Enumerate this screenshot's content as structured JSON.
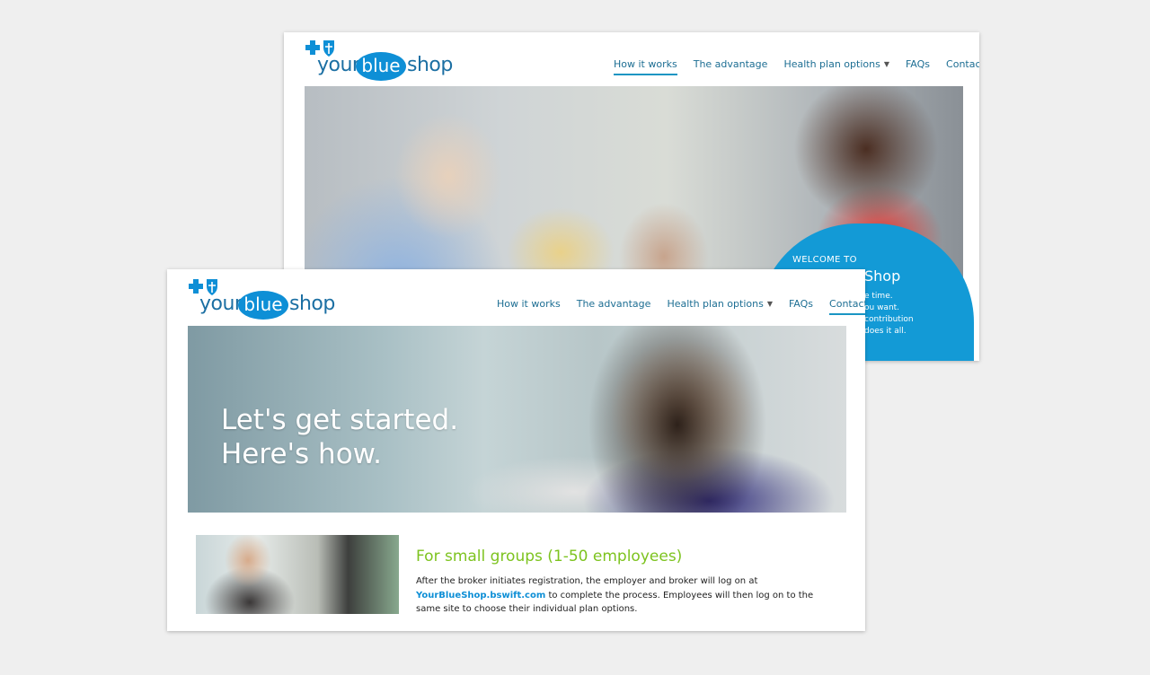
{
  "back": {
    "brand": {
      "part1": "your",
      "part2": "blue",
      "part3": "shop"
    },
    "nav": [
      {
        "label": "How it works",
        "active": true
      },
      {
        "label": "The advantage",
        "active": false
      },
      {
        "label": "Health plan options",
        "active": false,
        "dropdown": true
      },
      {
        "label": "FAQs",
        "active": false
      },
      {
        "label": "Contact",
        "active": false
      }
    ],
    "welcome": {
      "small": "WELCOME TO",
      "big": "Shop",
      "lines": [
        "e time.",
        "ou want.",
        "contribution",
        "does it all."
      ]
    }
  },
  "front": {
    "brand": {
      "part1": "your",
      "part2": "blue",
      "part3": "shop"
    },
    "nav": [
      {
        "label": "How it works",
        "active": false
      },
      {
        "label": "The advantage",
        "active": false
      },
      {
        "label": "Health plan options",
        "active": false,
        "dropdown": true
      },
      {
        "label": "FAQs",
        "active": false
      },
      {
        "label": "Contact",
        "active": true
      }
    ],
    "hero": {
      "line1": "Let's get started.",
      "line2": "Here's how."
    },
    "small_groups": {
      "title": "For small groups (1-50 employees)",
      "text_before": "After the broker initiates registration, the employer and broker will log on at",
      "link": "YourBlueShop.bswift.com",
      "text_after": "to complete the process. Employees will then log on to the same site to choose their individual plan options."
    }
  }
}
